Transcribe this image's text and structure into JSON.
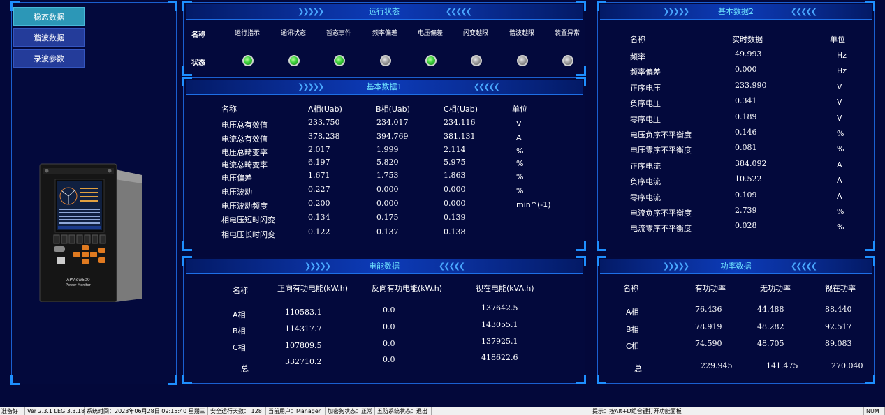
{
  "nav": {
    "items": [
      {
        "label": "稳态数据",
        "active": true
      },
      {
        "label": "谐波数据",
        "active": false
      },
      {
        "label": "录波参数",
        "active": false
      }
    ]
  },
  "device": {
    "model": "APView500",
    "subtitle": "Power Monitor"
  },
  "run_status": {
    "title": "运行状态",
    "name_header": "名称",
    "status_header": "状态",
    "items": [
      {
        "label": "运行指示",
        "state": "on"
      },
      {
        "label": "通讯状态",
        "state": "on"
      },
      {
        "label": "暂态事件",
        "state": "on"
      },
      {
        "label": "频率偏差",
        "state": "off"
      },
      {
        "label": "电压偏差",
        "state": "on"
      },
      {
        "label": "闪变越限",
        "state": "off"
      },
      {
        "label": "谐波越限",
        "state": "off"
      },
      {
        "label": "装置异常",
        "state": "off"
      }
    ]
  },
  "basic1": {
    "title": "基本数据1",
    "headers": [
      "名称",
      "A相(Uab)",
      "B相(Uab)",
      "C相(Uab)",
      "单位"
    ],
    "rows": [
      {
        "name": "电压总有效值",
        "a": "233.750",
        "b": "234.017",
        "c": "234.116",
        "unit": "V"
      },
      {
        "name": "电流总有效值",
        "a": "378.238",
        "b": "394.769",
        "c": "381.131",
        "unit": "A"
      },
      {
        "name": "电压总畸变率",
        "a": "2.017",
        "b": "1.999",
        "c": "2.114",
        "unit": "%"
      },
      {
        "name": "电流总畸变率",
        "a": "6.197",
        "b": "5.820",
        "c": "5.975",
        "unit": "%"
      },
      {
        "name": "电压偏差",
        "a": "1.671",
        "b": "1.753",
        "c": "1.863",
        "unit": "%"
      },
      {
        "name": "电压波动",
        "a": "0.227",
        "b": "0.000",
        "c": "0.000",
        "unit": "%"
      },
      {
        "name": "电压波动频度",
        "a": "0.200",
        "b": "0.000",
        "c": "0.000",
        "unit": "min^(-1)"
      },
      {
        "name": "相电压短时闪变",
        "a": "0.134",
        "b": "0.175",
        "c": "0.139",
        "unit": ""
      },
      {
        "name": "相电压长时闪变",
        "a": "0.122",
        "b": "0.137",
        "c": "0.138",
        "unit": ""
      }
    ]
  },
  "basic2": {
    "title": "基本数据2",
    "headers": [
      "名称",
      "实时数据",
      "单位"
    ],
    "rows": [
      {
        "name": "频率",
        "value": "49.993",
        "unit": "Hz"
      },
      {
        "name": "频率偏差",
        "value": "0.000",
        "unit": "Hz"
      },
      {
        "name": "正序电压",
        "value": "233.990",
        "unit": "V"
      },
      {
        "name": "负序电压",
        "value": "0.341",
        "unit": "V"
      },
      {
        "name": "零序电压",
        "value": "0.189",
        "unit": "V"
      },
      {
        "name": "电压负序不平衡度",
        "value": "0.146",
        "unit": "%"
      },
      {
        "name": "电压零序不平衡度",
        "value": "0.081",
        "unit": "%"
      },
      {
        "name": "正序电流",
        "value": "384.092",
        "unit": "A"
      },
      {
        "name": "负序电流",
        "value": "10.522",
        "unit": "A"
      },
      {
        "name": "零序电流",
        "value": "0.109",
        "unit": "A"
      },
      {
        "name": "电流负序不平衡度",
        "value": "2.739",
        "unit": "%"
      },
      {
        "name": "电流零序不平衡度",
        "value": "0.028",
        "unit": "%"
      }
    ]
  },
  "energy": {
    "title": "电能数据",
    "headers": [
      "名称",
      "正向有功电能(kW.h)",
      "反向有功电能(kW.h)",
      "视在电能(kVA.h)"
    ],
    "rows": [
      {
        "name": "A相",
        "fwd": "110583.1",
        "rev": "0.0",
        "app": "137642.5"
      },
      {
        "name": "B相",
        "fwd": "114317.7",
        "rev": "0.0",
        "app": "143055.1"
      },
      {
        "name": "C相",
        "fwd": "107809.5",
        "rev": "0.0",
        "app": "137925.1"
      },
      {
        "name": "总",
        "fwd": "332710.2",
        "rev": "0.0",
        "app": "418622.6"
      }
    ]
  },
  "power": {
    "title": "功率数据",
    "headers": [
      "名称",
      "有功功率",
      "无功功率",
      "视在功率"
    ],
    "rows": [
      {
        "name": "A相",
        "p": "76.436",
        "q": "44.488",
        "s": "88.440"
      },
      {
        "name": "B相",
        "p": "78.919",
        "q": "48.282",
        "s": "92.517"
      },
      {
        "name": "C相",
        "p": "74.590",
        "q": "48.705",
        "s": "89.083"
      },
      {
        "name": "总",
        "p": "229.945",
        "q": "141.475",
        "s": "270.040"
      }
    ]
  },
  "statusbar": {
    "ready": "准备好",
    "version": "Ver 2.3.1 LEG 3.3.18",
    "systime": "系统时间：2023年06月28日  09:15:40   星期三",
    "safe_days": "安全运行天数： 128",
    "user": "当前用户：Manager",
    "dongle": "加密狗状态：正常",
    "wufang": "五防系统状态：退出",
    "hint": "提示：按Alt+D组合键打开功能面板",
    "num": "NUM"
  },
  "colors": {
    "background": "#03083a",
    "panel_border": "#1a5fd0",
    "title_text": "#6fe3ff",
    "active_nav": "#2c97b7",
    "nav": "#243c9a",
    "led_on": "#3ad13a",
    "led_off": "#9a9a9a"
  }
}
